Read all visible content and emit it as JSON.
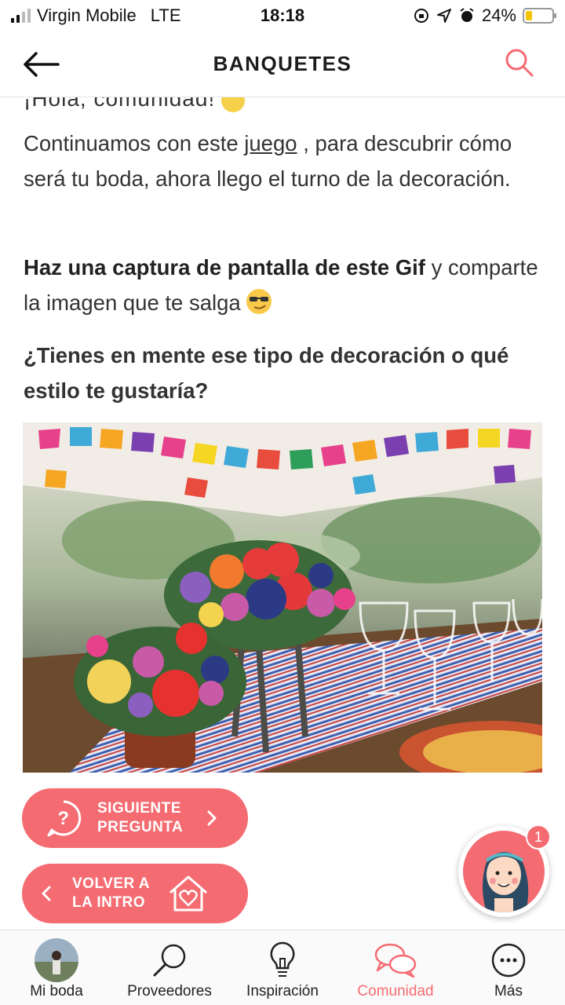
{
  "status_bar": {
    "carrier": "Virgin Mobile",
    "network": "LTE",
    "time": "18:18",
    "battery": "24%",
    "battery_level": 0.24
  },
  "header": {
    "title": "BANQUETES"
  },
  "content": {
    "cut_line": "¡Hola, comunidad!",
    "p1_before": "Continuamos con este ",
    "p1_link": "juego",
    "p1_after": " , para descubrir cómo será tu boda, ahora llego el turno de la decoración.",
    "p2_bold": "Haz una captura de pantalla de este Gif",
    "p2_rest": " y comparte la imagen que te salga",
    "p3": "¿Tienes en mente ese tipo de decoración o qué estilo te gustaría?"
  },
  "buttons": {
    "next_line1": "SIGUIENTE",
    "next_line2": "PREGUNTA",
    "intro_line1": "VOLVER A",
    "intro_line2": "LA INTRO"
  },
  "fab": {
    "badge": "1"
  },
  "nav": {
    "items": [
      {
        "label": "Mi boda",
        "icon": "avatar"
      },
      {
        "label": "Proveedores",
        "icon": "search-icon"
      },
      {
        "label": "Inspiración",
        "icon": "lightbulb-icon"
      },
      {
        "label": "Comunidad",
        "icon": "chat-bubbles-icon"
      },
      {
        "label": "Más",
        "icon": "more-icon"
      }
    ],
    "active": "Comunidad"
  },
  "colors": {
    "accent": "#f46c72",
    "battery": "#f5c400"
  }
}
